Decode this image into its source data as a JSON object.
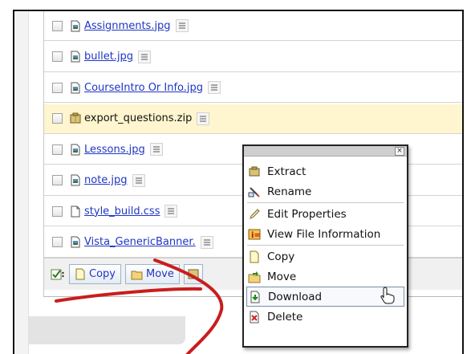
{
  "files": [
    {
      "name": "Assignments.jpg",
      "type": "image",
      "link": true
    },
    {
      "name": "bullet.jpg",
      "type": "image",
      "link": true
    },
    {
      "name": "CourseIntro Or Info.jpg",
      "type": "image",
      "link": true
    },
    {
      "name": "export_questions.zip",
      "type": "zip",
      "link": false,
      "selected": true
    },
    {
      "name": "Lessons.jpg",
      "type": "image",
      "link": true
    },
    {
      "name": "note.jpg",
      "type": "image",
      "link": true
    },
    {
      "name": "style_build.css",
      "type": "doc",
      "link": true
    },
    {
      "name": "Vista_GenericBanner.",
      "type": "image",
      "link": true
    }
  ],
  "toolbar": {
    "copy_label": "Copy",
    "move_label": "Move"
  },
  "context_menu": {
    "close_glyph": "×",
    "groups": [
      [
        {
          "label": "Extract",
          "icon": "zip-icon"
        },
        {
          "label": "Rename",
          "icon": "rename-icon"
        }
      ],
      [
        {
          "label": "Edit Properties",
          "icon": "pencil-icon"
        },
        {
          "label": "View File Information",
          "icon": "info-icon"
        }
      ],
      [
        {
          "label": "Copy",
          "icon": "copy-icon"
        },
        {
          "label": "Move",
          "icon": "move-icon"
        },
        {
          "label": "Download",
          "icon": "download-icon",
          "hover": true
        },
        {
          "label": "Delete",
          "icon": "delete-icon"
        }
      ]
    ]
  },
  "colors": {
    "link": "#1f36c4",
    "selected_row": "#fff5cf",
    "annotation_arrow": "#c81e1e"
  }
}
